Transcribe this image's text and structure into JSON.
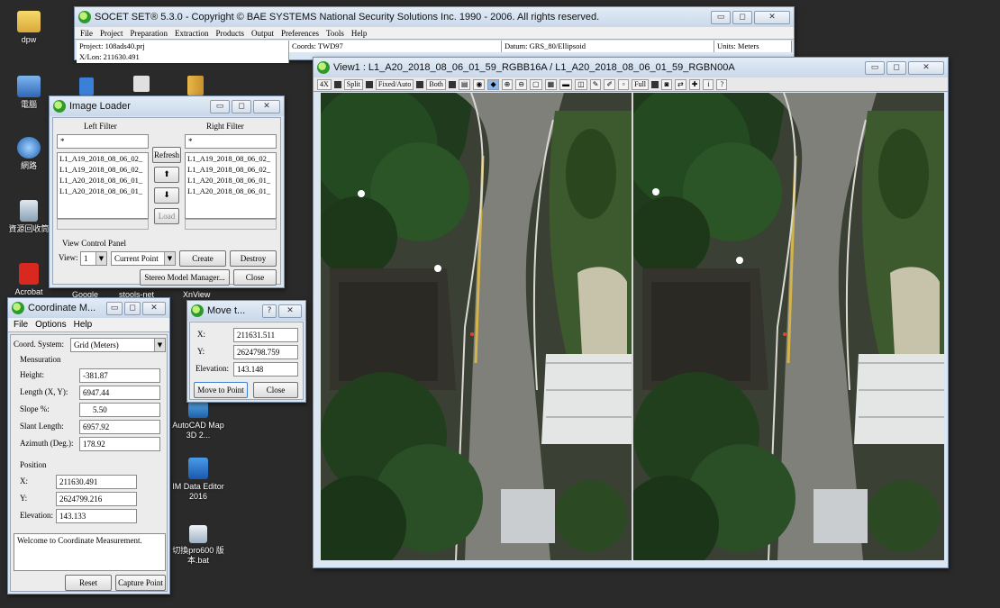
{
  "desktop": {
    "icons": [
      {
        "id": "dpw",
        "label": "dpw"
      },
      {
        "id": "computer",
        "label": "電腦"
      },
      {
        "id": "network",
        "label": "網路"
      },
      {
        "id": "recycle",
        "label": "資源回收筒"
      },
      {
        "id": "acrobat",
        "label": "Acrobat"
      },
      {
        "id": "google",
        "label": "Google"
      },
      {
        "id": "stools",
        "label": "stools-net"
      },
      {
        "id": "xnview",
        "label": "XnView"
      },
      {
        "id": "autocad",
        "label": "AutoCAD Map 3D 2..."
      },
      {
        "id": "imdata",
        "label": "IM Data Editor 2016"
      },
      {
        "id": "bat",
        "label": "切換pro600 版本.bat"
      }
    ]
  },
  "socet": {
    "title": "SOCET SET® 5.3.0 - Copyright © BAE SYSTEMS National Security Solutions Inc. 1990 - 2006. All rights reserved.",
    "menu": [
      "File",
      "Project",
      "Preparation",
      "Extraction",
      "Products",
      "Output",
      "Preferences",
      "Tools",
      "Help"
    ],
    "status": {
      "project": "Project: 108ads40.prj",
      "coords": "Coords: TWD97",
      "datum": "Datum: GRS_80/Ellipsoid",
      "units": "Units: Meters",
      "xlon": "X/Lon: 211630.491"
    }
  },
  "view1": {
    "title": "View1 : L1_A20_2018_08_06_01_59_RGBB16A / L1_A20_2018_08_06_01_59_RGBN00A",
    "toolbar": [
      "4X",
      "Split",
      "Fixed/Auto",
      "Both",
      "Full",
      "?"
    ]
  },
  "image_loader": {
    "title": "Image Loader",
    "left_filter_label": "Left Filter",
    "right_filter_label": "Right Filter",
    "left_filter_value": "*",
    "right_filter_value": "*",
    "left_list": [
      "L1_A19_2018_08_06_02_",
      "L1_A19_2018_08_06_02_",
      "L1_A20_2018_08_06_01_",
      "L1_A20_2018_08_06_01_"
    ],
    "right_list": [
      "L1_A19_2018_08_06_02_",
      "L1_A19_2018_08_06_02_",
      "L1_A20_2018_08_06_01_",
      "L1_A20_2018_08_06_01_"
    ],
    "refresh": "Refresh",
    "up": "⬆",
    "down": "⬇",
    "load": "Load",
    "view_control_label": "View Control Panel",
    "view_label": "View:",
    "view_value": "1",
    "point_value": "Current Point",
    "create": "Create",
    "destroy": "Destroy",
    "stereo_manager": "Stereo Model Manager...",
    "close": "Close"
  },
  "coord_meas": {
    "title": "Coordinate M...",
    "menu": [
      "File",
      "Options",
      "Help"
    ],
    "coord_system_label": "Coord. System:",
    "coord_system_value": "Grid (Meters)",
    "mensuration_label": "Mensuration",
    "height_label": "Height:",
    "height_value": "-381.87",
    "length_label": "Length (X, Y):",
    "length_value": "6947.44",
    "slope_label": "Slope %:",
    "slope_value": "5.50",
    "slant_label": "Slant Length:",
    "slant_value": "6957.92",
    "azimuth_label": "Azimuth (Deg.):",
    "azimuth_value": "178.92",
    "position_label": "Position",
    "x_label": "X:",
    "x_value": "211630.491",
    "y_label": "Y:",
    "y_value": "2624799.216",
    "elev_label": "Elevation:",
    "elev_value": "143.133",
    "message": "Welcome to Coordinate Measurement.",
    "reset": "Reset",
    "capture": "Capture Point"
  },
  "move_to": {
    "title": "Move t...",
    "x_label": "X:",
    "x_value": "211631.511",
    "y_label": "Y:",
    "y_value": "2624798.759",
    "elev_label": "Elevation:",
    "elev_value": "143.148",
    "move_button": "Move to Point",
    "close": "Close"
  },
  "colors": {
    "titlebar": "#c9d8ea",
    "window_bg": "#ececec",
    "desktop": "#2a2a2a"
  }
}
